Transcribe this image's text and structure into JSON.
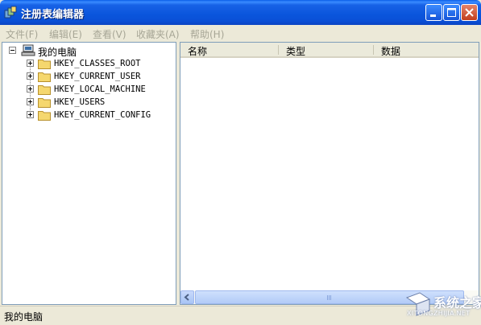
{
  "window": {
    "title": "注册表编辑器"
  },
  "menu": {
    "items": [
      {
        "label": "文件(F)"
      },
      {
        "label": "编辑(E)"
      },
      {
        "label": "查看(V)"
      },
      {
        "label": "收藏夹(A)"
      },
      {
        "label": "帮助(H)"
      }
    ]
  },
  "tree": {
    "root": {
      "label": "我的电脑",
      "icon": "computer-icon",
      "expanded": true
    },
    "children": [
      {
        "label": "HKEY_CLASSES_ROOT",
        "icon": "folder-icon"
      },
      {
        "label": "HKEY_CURRENT_USER",
        "icon": "folder-icon"
      },
      {
        "label": "HKEY_LOCAL_MACHINE",
        "icon": "folder-icon"
      },
      {
        "label": "HKEY_USERS",
        "icon": "folder-icon"
      },
      {
        "label": "HKEY_CURRENT_CONFIG",
        "icon": "folder-icon"
      }
    ]
  },
  "list": {
    "columns": [
      {
        "label": "名称"
      },
      {
        "label": "类型"
      },
      {
        "label": "数据"
      }
    ],
    "rows": []
  },
  "scrollbar": {
    "grip": "III"
  },
  "status": {
    "text": "我的电脑"
  },
  "watermark": {
    "text": "系统之家",
    "sub": "XITONGZHIJIA.NET"
  },
  "colors": {
    "titlebar": "#0a55dc",
    "accent": "#3a8bff",
    "close": "#c23f1e"
  }
}
